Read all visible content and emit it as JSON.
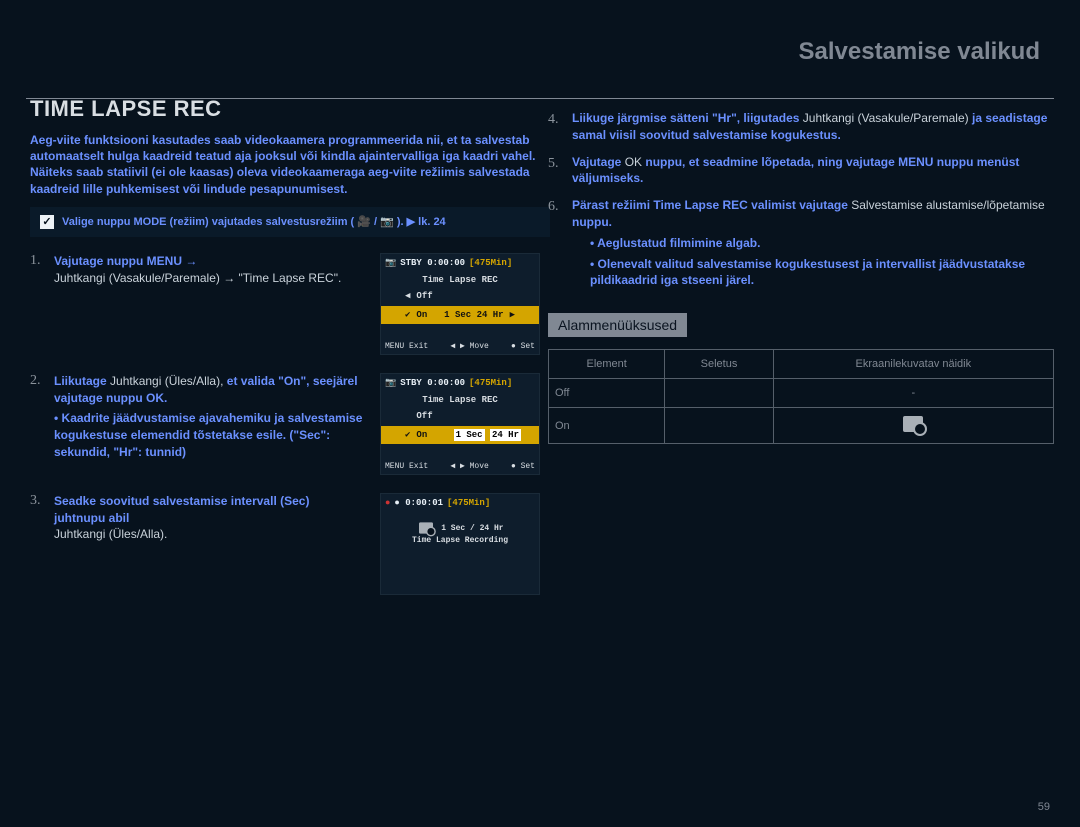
{
  "header": {
    "section": "Salvestamise valikud"
  },
  "title": "TIME LAPSE REC",
  "intro": "Aeg-viite funktsiooni kasutades saab videokaamera programmeerida nii, et ta salvestab automaatselt hulga kaadreid teatud aja jooksul või kindla ajaintervalliga iga kaadri vahel. Näiteks saab statiivil (ei ole kaasas) oleva videokaameraga aeg-viite režiimis salvestada kaadreid lille puhkemisest või lindude pesapunumisest.",
  "note": {
    "icon": "✓",
    "text": "Valige nuppu MODE (režiim) vajutades salvestusrežiim ( 🎥 / 📷 ). ▶ lk. 24"
  },
  "steps_left": [
    {
      "num": "1.",
      "bold": "Vajutage nuppu MENU →",
      "rest": "Juhtkangi (Vasakule/Paremale) → \"Time Lapse REC\".",
      "lcd": {
        "top_left": "STBY 0:00:00",
        "top_right": "[475Min]",
        "menu_title": "Time Lapse REC",
        "rows": [
          {
            "label": "Off",
            "selected": false
          },
          {
            "label": "On",
            "selected": true
          }
        ],
        "sec": "1 Sec",
        "hr": "24 Hr",
        "bottom": [
          "MENU Exit",
          "◀ ▶ Move",
          "● Set"
        ]
      }
    },
    {
      "num": "2.",
      "bold": "Liikutage",
      "bold2_pre": "Juhtkangi (Üles/Alla),",
      "bold2": "et valida \"On\", seejärel vajutage nuppu OK.",
      "bullet": "• Kaadrite jäädvustamise ajavahemiku ja salvestamise kogukestuse elemendid tõstetakse esile. (\"Sec\": sekundid, \"Hr\": tunnid)",
      "lcd": {
        "top_left": "STBY 0:00:00",
        "top_right": "[475Min]",
        "menu_title": "Time Lapse REC",
        "rows": [
          {
            "label": "Off",
            "selected": false
          },
          {
            "label": "On",
            "selected": true
          }
        ],
        "box_sec": "1 Sec",
        "box_hr": "24 Hr",
        "bottom": [
          "MENU Exit",
          "◀ ▶ Move",
          "● Set"
        ]
      }
    },
    {
      "num": "3.",
      "bold": "Seadke soovitud salvestamise intervall (Sec) juhtnupu abil",
      "rest": "Juhtkangi (Üles/Alla).",
      "lcd": {
        "top_left": "● 0:00:01",
        "top_right": "[475Min]",
        "line1": "1 Sec / 24 Hr",
        "line2": "Time Lapse Recording"
      }
    }
  ],
  "steps_right": [
    {
      "num": "4.",
      "bold": "Liikuge järgmise sätteni \"Hr\", liigutades",
      "rest_pre": "Juhtkangi (Vasakule/Paremale)",
      "bold2": " ja seadistage samal viisil soovitud salvestamise kogukestus."
    },
    {
      "num": "5.",
      "bold": "Vajutage",
      "rest": " OK ",
      "bold2": "nuppu, et seadmine lõpetada, ning vajutage MENU nuppu menüst väljumiseks."
    },
    {
      "num": "6.",
      "bold": "Pärast režiimi Time Lapse REC valimist vajutage",
      "rest": "Salvestamise alustamise/lõpetamise",
      "bold2": " nuppu.",
      "bullets": [
        "Aeglustatud filmimine algab.",
        "Olenevalt valitud salvestamise kogukestusest ja intervallist jäädvustatakse pildikaadrid iga stseeni järel."
      ]
    }
  ],
  "subheading": "Alammenüüksused",
  "table": {
    "headers": [
      "Element",
      "Seletus",
      "Ekraanilekuvatav näidik"
    ],
    "rows": [
      {
        "element": "Off",
        "desc": "",
        "icon": "-"
      },
      {
        "element": "On",
        "desc": "",
        "icon": "timelapse"
      }
    ]
  },
  "page_number": "59"
}
